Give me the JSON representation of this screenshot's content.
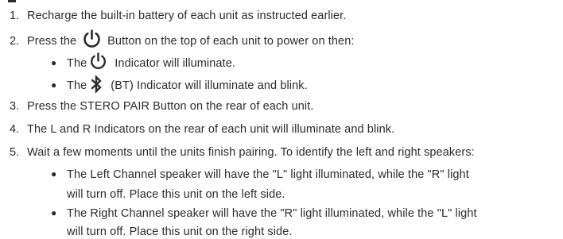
{
  "steps": [
    {
      "num": "1.",
      "text": "Recharge the built-in battery of each unit as instructed earlier."
    },
    {
      "num": "2.",
      "text_before": "Press the",
      "icon": "power-icon",
      "text_after": "Button on the top of each unit to power on then:",
      "bullets": [
        {
          "before": "The",
          "icon": "power-icon",
          "after": "Indicator will illuminate."
        },
        {
          "before": "The",
          "icon": "bluetooth-icon",
          "after": "(BT) Indicator will illuminate and blink."
        }
      ]
    },
    {
      "num": "3.",
      "text": "Press the STERO PAIR Button on the rear of each unit."
    },
    {
      "num": "4.",
      "text": "The L and R Indicators on the rear of each unit will illuminate and blink."
    },
    {
      "num": "5.",
      "text": "Wait a few moments until the units finish pairing. To identify the left and right speakers:",
      "bullets": [
        {
          "line1": "The Left Channel speaker will have the \"L\" light illuminated, while the \"R\" light",
          "line2": "will turn off. Place this unit on the left side."
        },
        {
          "line1": "The Right Channel speaker will have the \"R\" light illuminated, while the \"L\" light",
          "line2": "will turn off. Place this unit on the right side."
        }
      ]
    }
  ],
  "bullet_char": "●"
}
